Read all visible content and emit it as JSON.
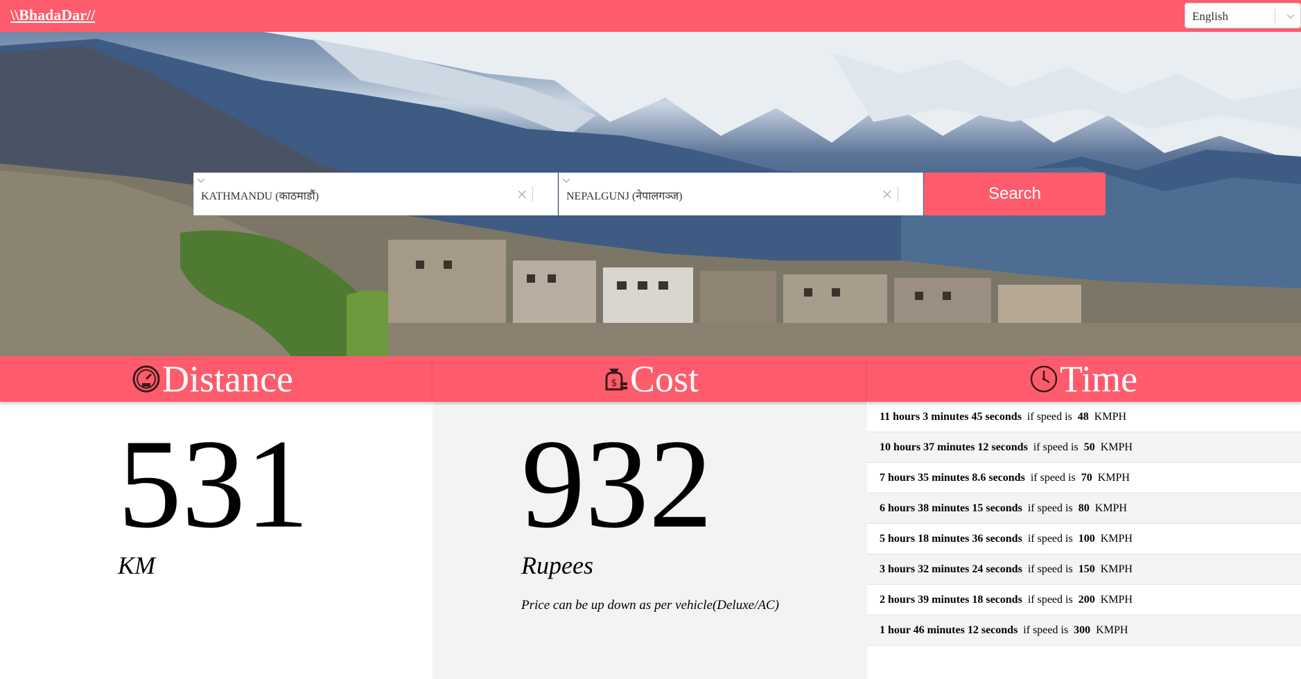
{
  "header": {
    "brand": "\\\\BhadaDar//",
    "language": {
      "value": "English",
      "icon": "chevron-down-icon"
    }
  },
  "search": {
    "from": {
      "value": "KATHMANDU (काठमाडौं)"
    },
    "to": {
      "value": "NEPALGUNJ (नेपालगञ्ज)"
    },
    "clear_glyph": "×",
    "button_label": "Search"
  },
  "distance": {
    "title": "Distance",
    "icon": "speedometer-icon",
    "value": "531",
    "unit": "KM"
  },
  "cost": {
    "title": "Cost",
    "icon": "money-bag-icon",
    "value": "932",
    "unit": "Rupees",
    "note": "Price can be up down as per vehicle(Deluxe/AC)"
  },
  "time": {
    "title": "Time",
    "icon": "clock-icon",
    "speed_prefix": "if speed is",
    "speed_unit": "KMPH",
    "rows": [
      {
        "duration": "11 hours 3 minutes 45 seconds",
        "speed": "48"
      },
      {
        "duration": "10 hours 37 minutes 12 seconds",
        "speed": "50"
      },
      {
        "duration": "7 hours 35 minutes 8.6 seconds",
        "speed": "70"
      },
      {
        "duration": "6 hours 38 minutes 15 seconds",
        "speed": "80"
      },
      {
        "duration": "5 hours 18 minutes 36 seconds",
        "speed": "100"
      },
      {
        "duration": "3 hours 32 minutes 24 seconds",
        "speed": "150"
      },
      {
        "duration": "2 hours 39 minutes 18 seconds",
        "speed": "200"
      },
      {
        "duration": "1 hour 46 minutes 12 seconds",
        "speed": "300"
      }
    ]
  },
  "colors": {
    "accent": "#fe5c6c",
    "cost_bg": "#f3f3f5"
  }
}
